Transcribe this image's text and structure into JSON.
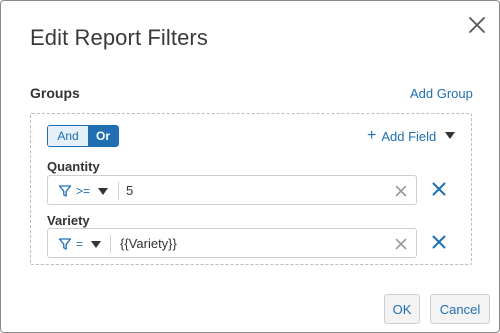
{
  "dialog": {
    "title": "Edit Report Filters"
  },
  "groups": {
    "label": "Groups",
    "add_group_label": "Add Group",
    "logic_toggle": {
      "and_label": "And",
      "or_label": "Or",
      "selected": "Or"
    },
    "add_field_label": "Add Field",
    "filters": [
      {
        "label": "Quantity",
        "operator": ">=",
        "value": "5"
      },
      {
        "label": "Variety",
        "operator": "=",
        "value": "{{Variety}}"
      }
    ]
  },
  "footer": {
    "ok_label": "OK",
    "cancel_label": "Cancel"
  },
  "colors": {
    "accent": "#1f6fb2",
    "border": "#cfcfcf"
  },
  "icons": [
    "close-icon",
    "plus-icon",
    "chevron-down-icon",
    "filter-icon",
    "clear-icon",
    "remove-icon"
  ]
}
